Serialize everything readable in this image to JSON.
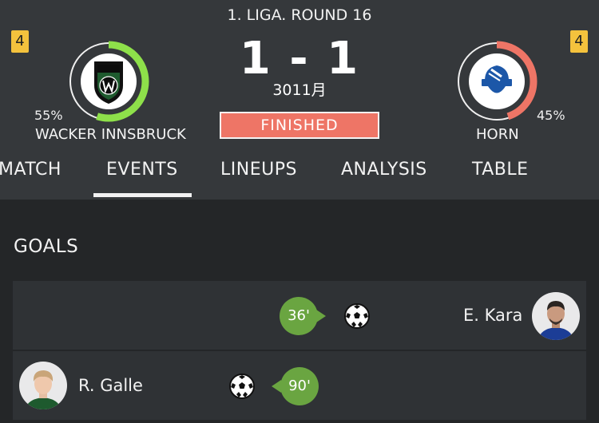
{
  "match": {
    "competition": "1. LIGA. ROUND 16",
    "score": "1 - 1",
    "date": "3011月",
    "status": "FINISHED"
  },
  "home": {
    "name": "WACKER INNSBRUCK",
    "possession": "55%",
    "badge": "4",
    "ring_color": "#8ee04a",
    "possession_value": 0.55,
    "logo_icon": "wacker-innsbruck-crest-icon"
  },
  "away": {
    "name": "HORN",
    "possession": "45%",
    "badge": "4",
    "ring_color": "#ee7566",
    "possession_value": 0.45,
    "logo_icon": "sv-horn-crest-icon"
  },
  "tabs": [
    {
      "label": "MATCH"
    },
    {
      "label": "EVENTS",
      "active": true
    },
    {
      "label": "LINEUPS"
    },
    {
      "label": "ANALYSIS"
    },
    {
      "label": "TABLE"
    }
  ],
  "events": {
    "section_title": "GOALS",
    "goals": [
      {
        "minute": "36'",
        "player": "E. Kara",
        "team": "away",
        "icon": "soccer-ball-icon"
      },
      {
        "minute": "90'",
        "player": "R. Galle",
        "team": "home",
        "icon": "soccer-ball-icon"
      }
    ]
  },
  "colors": {
    "accent_green": "#6aa541",
    "status_red": "#ee7566",
    "badge_yellow": "#f4c23d"
  }
}
